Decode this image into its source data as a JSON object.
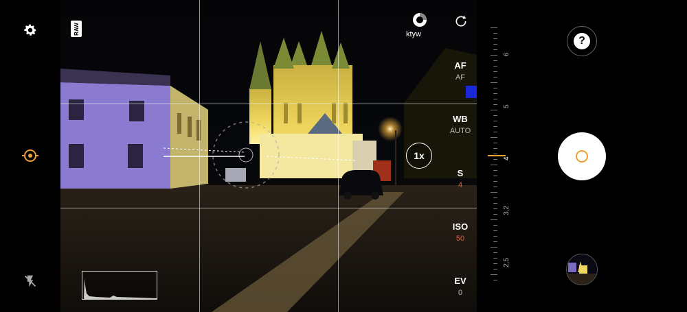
{
  "toolbar": {
    "raw_badge": "RAW",
    "mode_label": "ktyw"
  },
  "zoom": {
    "label": "1x"
  },
  "settings": [
    {
      "name": "AF",
      "value": "AF"
    },
    {
      "name": "WB",
      "value": "AUTO"
    },
    {
      "name": "S",
      "value": "4"
    },
    {
      "name": "ISO",
      "value": "50"
    },
    {
      "name": "EV",
      "value": "0"
    }
  ],
  "dial": {
    "labels": [
      "6",
      "5",
      "4",
      "3,2",
      "2,5"
    ],
    "selected": "4"
  },
  "controls": {
    "help_label": "?"
  },
  "colors": {
    "accent": "#f0a030",
    "active_value": "#e35a3c",
    "value": "#bbbbbb",
    "chip": "#1b28d8"
  },
  "icons": {
    "settings": "gear-icon",
    "metering": "metering-icon",
    "flash": "flash-off-icon",
    "lens_mode": "lens-mode-icon",
    "rotate": "rotate-icon",
    "help": "help-icon",
    "shutter": "shutter-icon"
  }
}
